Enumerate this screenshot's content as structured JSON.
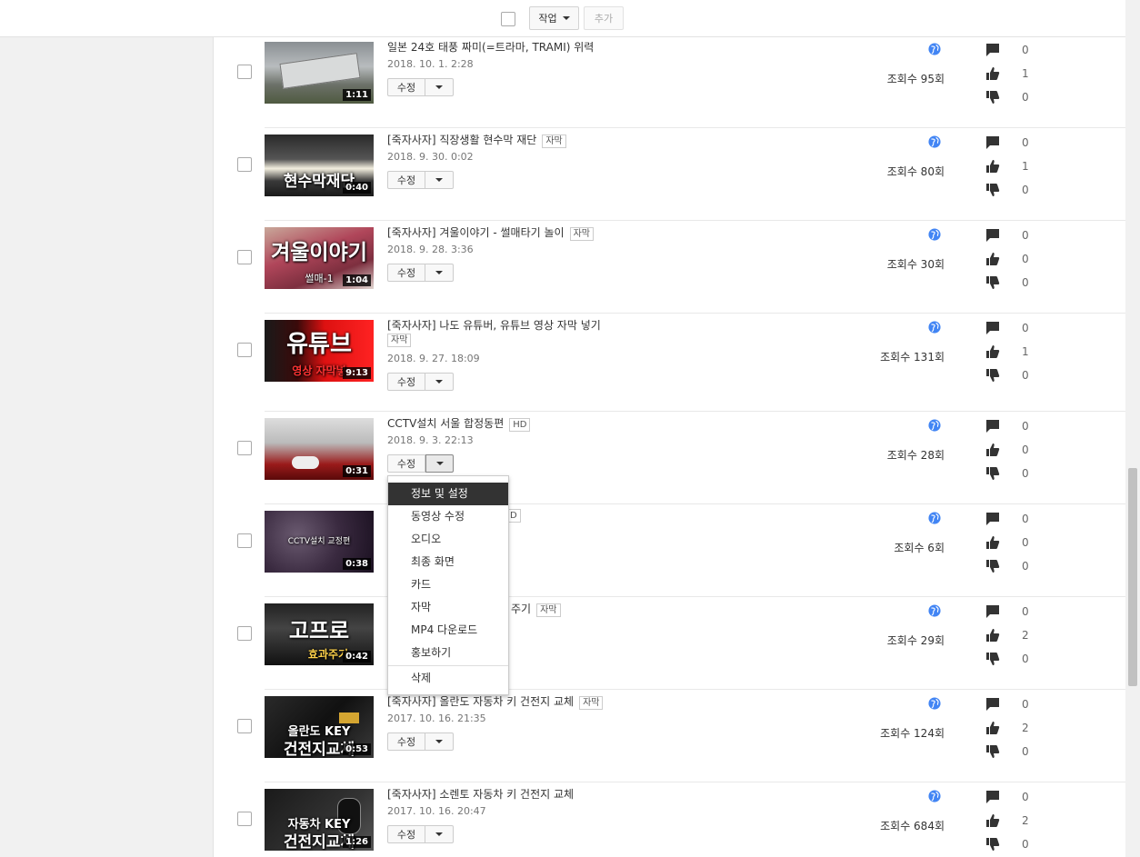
{
  "toolbar": {
    "action_label": "작업",
    "add_label": "추가"
  },
  "colors": {
    "accent": "#4285f4",
    "icon": "#333333"
  },
  "videos": [
    {
      "title": "일본 24호 태풍 짜미(=트라마, TRAMI) 위력",
      "badge": "",
      "date": "2018. 10. 1. 2:28",
      "edit_label": "수정",
      "views": "조회수 95회",
      "comments": "0",
      "likes": "1",
      "dislikes": "0",
      "duration": "1:11",
      "thumb_text": "",
      "thumb_sub": ""
    },
    {
      "title": "[죽자사자] 직장생활 현수막 재단",
      "badge": "자막",
      "date": "2018. 9. 30. 0:02",
      "edit_label": "수정",
      "views": "조회수 80회",
      "comments": "0",
      "likes": "1",
      "dislikes": "0",
      "duration": "0:40",
      "thumb_text": "현수막재단",
      "thumb_sub": ""
    },
    {
      "title": "[죽자사자] 겨울이야기 - 썰매타기 놀이",
      "badge": "자막",
      "date": "2018. 9. 28. 3:36",
      "edit_label": "수정",
      "views": "조회수 30회",
      "comments": "0",
      "likes": "0",
      "dislikes": "0",
      "duration": "1:04",
      "thumb_text": "겨울이야기",
      "thumb_sub": "썰매-1"
    },
    {
      "title": "[죽자사자] 나도 유튜버, 유튜브 영상 자막 넣기",
      "badge": "자막",
      "date": "2018. 9. 27. 18:09",
      "edit_label": "수정",
      "views": "조회수 131회",
      "comments": "0",
      "likes": "1",
      "dislikes": "0",
      "duration": "9:13",
      "thumb_text": "유튜브",
      "thumb_sub": "영상 자막넣"
    },
    {
      "title": "CCTV설치 서울 합정동편",
      "badge": "HD",
      "date": "2018. 9. 3. 22:13",
      "edit_label": "수정",
      "views": "조회수 28회",
      "comments": "0",
      "likes": "0",
      "dislikes": "0",
      "duration": "0:31",
      "thumb_text": "",
      "thumb_sub": ""
    },
    {
      "title": "",
      "badge": "D",
      "date": "",
      "edit_label": "",
      "views": "조회수 6회",
      "comments": "0",
      "likes": "0",
      "dislikes": "0",
      "duration": "0:38",
      "thumb_text": "",
      "thumb_sub": "CCTV설치 교정편"
    },
    {
      "title": "주기",
      "badge": "자막",
      "date": "",
      "edit_label": "",
      "views": "조회수 29회",
      "comments": "0",
      "likes": "2",
      "dislikes": "0",
      "duration": "0:42",
      "thumb_text": "고프로",
      "thumb_sub": "효과주기"
    },
    {
      "title": "[죽자사자] 올란도 자동차 키 건전지 교체",
      "badge": "자막",
      "date": "2017. 10. 16. 21:35",
      "edit_label": "수정",
      "views": "조회수 124회",
      "comments": "0",
      "likes": "2",
      "dislikes": "0",
      "duration": "0:53",
      "thumb_text": "올란도 KEY",
      "thumb_sub": "건전지교체"
    },
    {
      "title": "[죽자사자] 소렌토 자동차 키 건전지 교체",
      "badge": "",
      "date": "2017. 10. 16. 20:47",
      "edit_label": "수정",
      "views": "조회수 684회",
      "comments": "0",
      "likes": "2",
      "dislikes": "0",
      "duration": "1:26",
      "thumb_text": "자동차 KEY",
      "thumb_sub": "건전지교체"
    }
  ],
  "menu": {
    "items": [
      "정보 및 설정",
      "동영상 수정",
      "오디오",
      "최종 화면",
      "카드",
      "자막",
      "MP4 다운로드",
      "홍보하기"
    ],
    "delete_label": "삭제"
  }
}
